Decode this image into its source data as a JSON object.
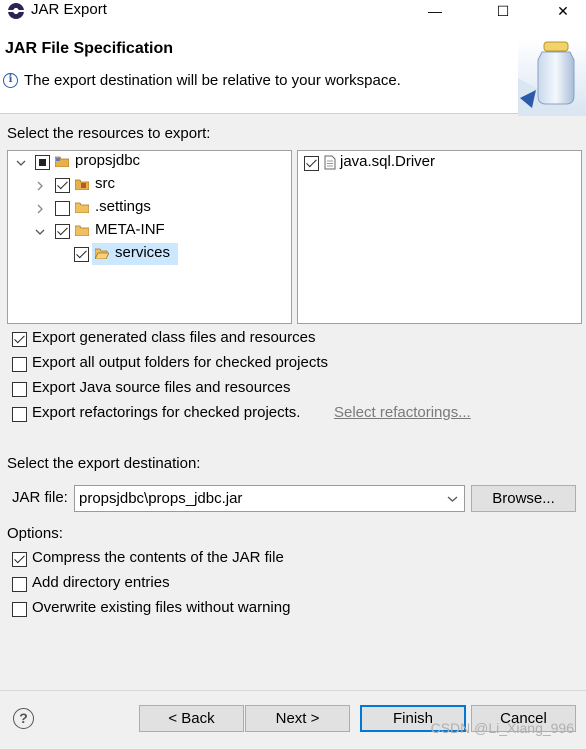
{
  "window": {
    "title": "JAR Export",
    "minimize": "—",
    "maximize": "☐",
    "close": "✕"
  },
  "header": {
    "title": "JAR File Specification",
    "info_glyph": "i",
    "message": "The export destination will be relative to your workspace."
  },
  "resources": {
    "label": "Select the resources to export:",
    "tree": [
      {
        "label": "propsjdbc",
        "state": "partial",
        "icon": "project-folder-icon"
      },
      {
        "label": "src",
        "state": "checked",
        "icon": "package-folder-icon"
      },
      {
        "label": ".settings",
        "state": "unchecked",
        "icon": "folder-icon"
      },
      {
        "label": "META-INF",
        "state": "checked",
        "icon": "folder-icon"
      },
      {
        "label": "services",
        "state": "checked",
        "icon": "folder-open-icon",
        "selected": true
      }
    ],
    "files": [
      {
        "label": "java.sql.Driver",
        "state": "checked",
        "icon": "file-icon"
      }
    ]
  },
  "options_top": [
    {
      "label": "Export generated class files and resources",
      "checked": true
    },
    {
      "label": "Export all output folders for checked projects",
      "checked": false
    },
    {
      "label": "Export Java source files and resources",
      "checked": false
    },
    {
      "label": "Export refactorings for checked projects.",
      "checked": false
    }
  ],
  "select_refactorings": "Select refactorings...",
  "destination": {
    "label": "Select the export destination:",
    "jar_label": "JAR file:",
    "jar_value": "propsjdbc\\props_jdbc.jar",
    "browse": "Browse..."
  },
  "options": {
    "label": "Options:",
    "items": [
      {
        "label": "Compress the contents of the JAR file",
        "checked": true
      },
      {
        "label": "Add directory entries",
        "checked": false
      },
      {
        "label": "Overwrite existing files without warning",
        "checked": false
      }
    ]
  },
  "footer": {
    "help_glyph": "?",
    "back": "< Back",
    "next": "Next >",
    "finish": "Finish",
    "cancel": "Cancel"
  },
  "watermark": "CSDN @Li_Xiang_996",
  "colors": {
    "selection": "#cce8ff",
    "default_button_border": "#0078d7",
    "folder": "#e0a030"
  }
}
